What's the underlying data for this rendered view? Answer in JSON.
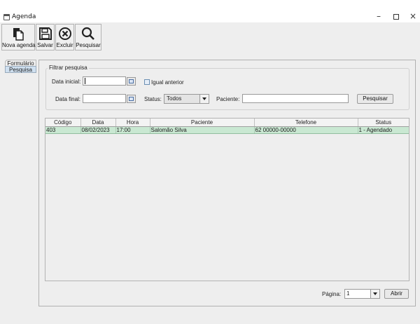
{
  "window": {
    "title": "Agenda",
    "minimize": "–",
    "close": "×"
  },
  "toolbar": {
    "nova_label": "Nova agenda",
    "salvar_label": "Salvar",
    "excluir_label": "Excluir",
    "pesquisar_label": "Pesquisar"
  },
  "tabs": [
    {
      "label": "Formulário"
    },
    {
      "label": "Pesquisa"
    }
  ],
  "filter": {
    "legend": "Filtrar pesquisa",
    "data_inicial_label": "Data inicial:",
    "data_inicial_value": "",
    "igual_anterior_label": "Igual anterior",
    "data_final_label": "Data final:",
    "data_final_value": "",
    "status_label": "Status:",
    "status_value": "Todos",
    "paciente_label": "Paciente:",
    "paciente_value": "",
    "pesquisar_button": "Pesquisar"
  },
  "table": {
    "columns": [
      "Código",
      "Data",
      "Hora",
      "Paciente",
      "Telefone",
      "Status"
    ],
    "rows": [
      [
        "403",
        "08/02/2023",
        "17:00",
        "Salomão Silva",
        "62 00000-00000",
        "1 - Agendado"
      ]
    ]
  },
  "pager": {
    "label": "Página:",
    "value": "1",
    "open_button": "Abrir"
  },
  "colors": {
    "selected_row": "#c9e8d2",
    "active_tab": "#cfe0f0"
  },
  "icons": [
    "calendar-window-icon",
    "new-document-icon",
    "save-icon",
    "delete-icon",
    "search-icon",
    "calendar-icon"
  ]
}
